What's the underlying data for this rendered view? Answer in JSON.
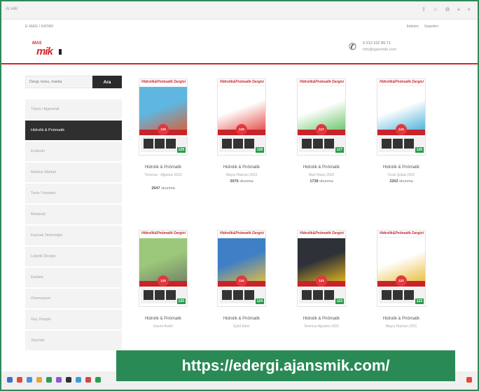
{
  "browser": {
    "tab_text": "Ar.wiki",
    "tool_icons": [
      "share-icon",
      "star-icon",
      "settings-icon",
      "menu-icon",
      "close-icon"
    ]
  },
  "header": {
    "breadcrumb": "E-MAG  /  KATAR",
    "top_links": [
      "Iletisim",
      "Sepetim"
    ],
    "logo_top": "MAS",
    "logo_mark": "mik",
    "phone": "0 212 222 89 71",
    "email": "info@ajansmik.com"
  },
  "search": {
    "placeholder": "Dergi, konu, marka",
    "button": "Ara"
  },
  "sidebar": {
    "items": [
      {
        "label": "Tümü / Ajansmik",
        "active": false
      },
      {
        "label": "Hidrolik & Pnömatik",
        "active": true
      },
      {
        "label": "Endüstri",
        "active": false
      },
      {
        "label": "Makine Market",
        "active": false
      },
      {
        "label": "Tesis Yönetimi",
        "active": false
      },
      {
        "label": "Metalurji",
        "active": false
      },
      {
        "label": "Kaynak Teknolojisi",
        "active": false
      },
      {
        "label": "Lojistik Dergisi",
        "active": false
      },
      {
        "label": "Elektrik",
        "active": false
      },
      {
        "label": "Otomasyon",
        "active": false
      },
      {
        "label": "Güç Dergisi",
        "active": false
      },
      {
        "label": "Yayınlar",
        "active": false
      }
    ]
  },
  "products": [
    {
      "masthead": "Hidrolik&Pnömatik Dergisi",
      "title": "Hidrolik & Pnömatik",
      "subtitle": "Temmuz - Ağustos 2022",
      "views": "2647",
      "views_label": "okunma",
      "badge": "129",
      "issue": "129",
      "art": "#5fb6e0",
      "art2": "#e45a2a"
    },
    {
      "masthead": "Hidrolik&Pnömatik Dergisi",
      "title": "Hidrolik & Pnömatik",
      "subtitle": "Mayıs Haziran 2022",
      "views": "2076",
      "views_label": "okunma",
      "badge": "128",
      "issue": "128",
      "art": "#ffffff",
      "art2": "#e23c35"
    },
    {
      "masthead": "Hidrolik&Pnömatik Dergisi",
      "title": "Hidrolik & Pnömatik",
      "subtitle": "Mart Nisan 2022",
      "views": "1738",
      "views_label": "okunma",
      "badge": "127",
      "issue": "127",
      "art": "#ffffff",
      "art2": "#5bbf5a"
    },
    {
      "masthead": "Hidrolik&Pnömatik Dergisi",
      "title": "Hidrolik & Pnömatik",
      "subtitle": "Ocak Şubat 2022",
      "views": "2202",
      "views_label": "okunma",
      "badge": "126",
      "issue": "126",
      "art": "#ffffff",
      "art2": "#3aa8d6"
    },
    {
      "masthead": "Hidrolik&Pnömatik Dergisi",
      "title": "Hidrolik & Pnömatik",
      "subtitle": "Kasım Aralık",
      "views": "",
      "views_label": "",
      "badge": "125",
      "issue": "125",
      "art": "#9bc77a",
      "art2": "#6f7d66"
    },
    {
      "masthead": "Hidrolik&Pnömatik Dergisi",
      "title": "Hidrolik & Pnömatik",
      "subtitle": "Eylül Ekim",
      "views": "",
      "views_label": "",
      "badge": "124",
      "issue": "124",
      "art": "#3f7fc5",
      "art2": "#f0c23a"
    },
    {
      "masthead": "Hidrolik&Pnömatik Dergisi",
      "title": "Hidrolik & Pnömatik",
      "subtitle": "Temmuz Ağustos 2021",
      "views": "",
      "views_label": "",
      "badge": "123",
      "issue": "123",
      "art": "#2e3138",
      "art2": "#f3c21c"
    },
    {
      "masthead": "Hidrolik&Pnömatik Dergisi",
      "title": "Hidrolik & Pnömatik",
      "subtitle": "Mayıs Haziran 2021",
      "views": "",
      "views_label": "",
      "badge": "122",
      "issue": "122",
      "art": "#ffffff",
      "art2": "#e7b62a"
    }
  ],
  "banner": {
    "text": "https://edergi.ajansmik.com/"
  },
  "colors": {
    "accent_red": "#d9242a",
    "banner_green": "#2a8a55",
    "active_menu": "#2f2f2f"
  }
}
